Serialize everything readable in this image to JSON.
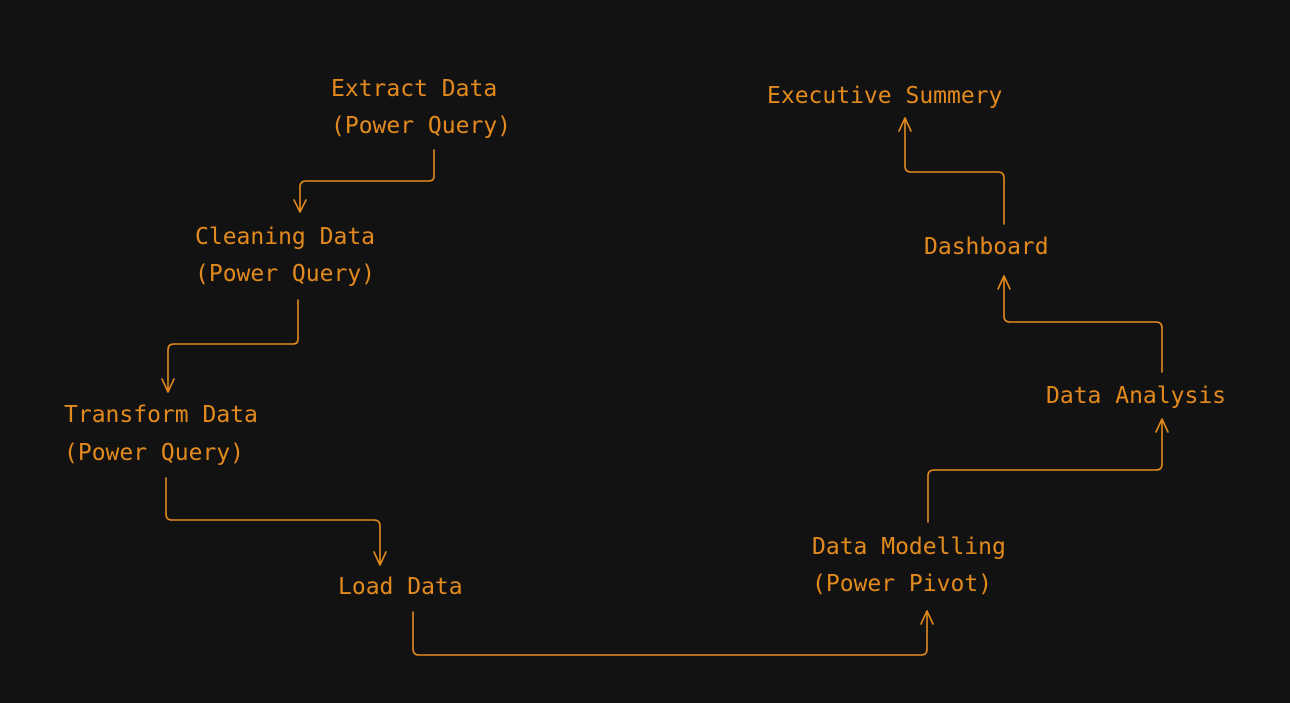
{
  "colors": {
    "background": "#121212",
    "accent": "#e38a1e"
  },
  "nodes": {
    "extract": {
      "line1": "Extract Data",
      "line2": "(Power Query)"
    },
    "cleaning": {
      "line1": "Cleaning Data",
      "line2": "(Power Query)"
    },
    "transform": {
      "line1": "Transform Data",
      "line2": "(Power Query)"
    },
    "load": {
      "line1": "Load Data"
    },
    "modelling": {
      "line1": "Data Modelling",
      "line2": "(Power Pivot)"
    },
    "analysis": {
      "line1": "Data Analysis"
    },
    "dashboard": {
      "line1": "Dashboard"
    },
    "summary": {
      "line1": "Executive Summery"
    }
  },
  "edges": [
    {
      "from": "extract",
      "to": "cleaning"
    },
    {
      "from": "cleaning",
      "to": "transform"
    },
    {
      "from": "transform",
      "to": "load"
    },
    {
      "from": "load",
      "to": "modelling"
    },
    {
      "from": "modelling",
      "to": "analysis"
    },
    {
      "from": "analysis",
      "to": "dashboard"
    },
    {
      "from": "dashboard",
      "to": "summary"
    }
  ]
}
